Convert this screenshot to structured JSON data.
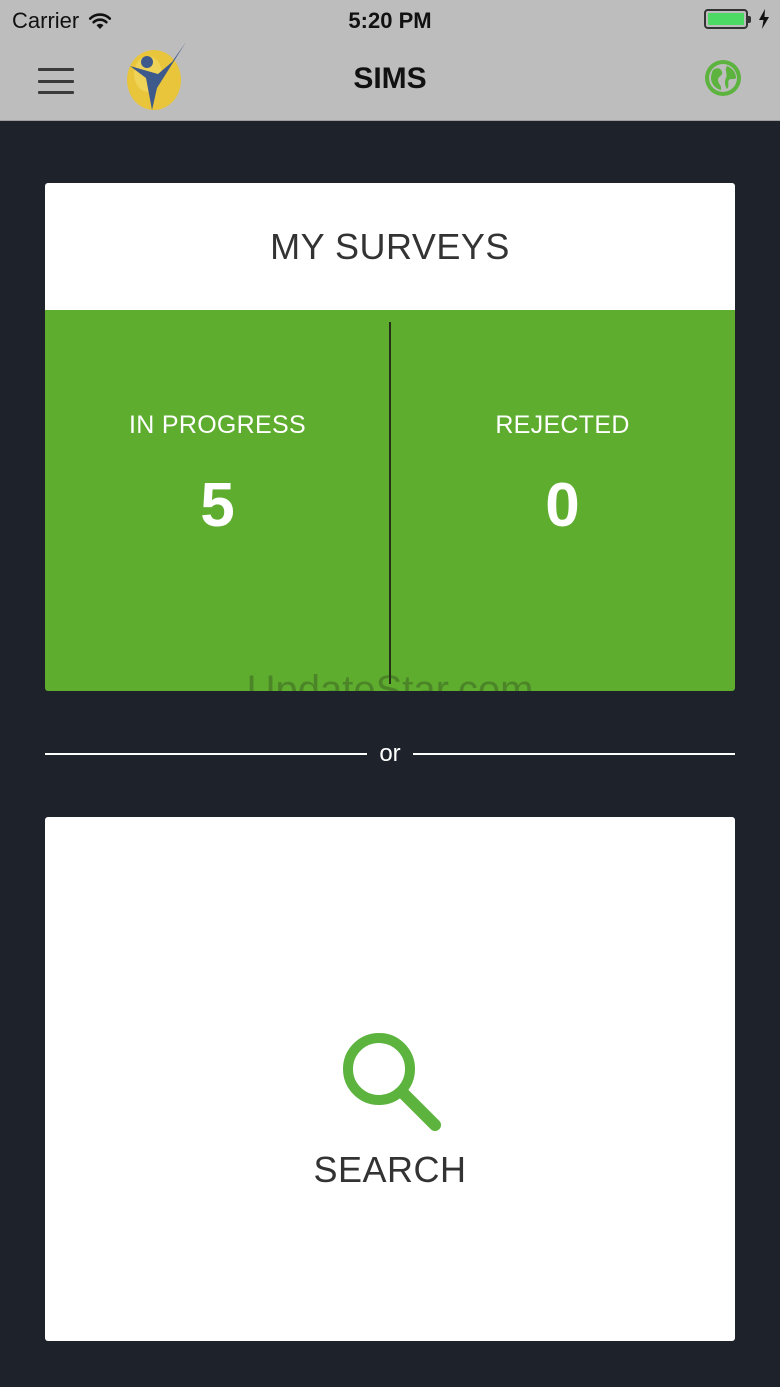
{
  "status_bar": {
    "carrier": "Carrier",
    "time": "5:20 PM",
    "battery_level": 1.0
  },
  "nav": {
    "title": "SIMS",
    "menu_icon": "hamburger-menu-icon",
    "logo": "sims-logo",
    "globe_icon": "globe-icon"
  },
  "surveys": {
    "header": "MY SURVEYS",
    "stats": [
      {
        "label": "IN PROGRESS",
        "value": "5"
      },
      {
        "label": "REJECTED",
        "value": "0"
      }
    ],
    "watermark": "UpdateStar.com"
  },
  "separator": {
    "text": "or"
  },
  "search": {
    "label": "SEARCH",
    "icon": "search-icon"
  },
  "colors": {
    "background": "#1e222b",
    "bar": "#bdbdbd",
    "accent_green": "#5ead2e",
    "globe_green": "#5cb33d",
    "battery_green": "#4cd964"
  }
}
